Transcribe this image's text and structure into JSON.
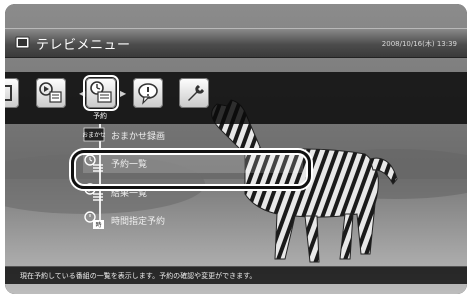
{
  "window": {
    "title": "テレビメニュー",
    "clock": "2008/10/16(木) 13:39"
  },
  "iconbar": {
    "items": [
      {
        "icon": "grid-icon"
      },
      {
        "icon": "program-guide-icon"
      },
      {
        "icon": "reservation-clock-icon",
        "label": "予約",
        "selected": true
      },
      {
        "icon": "speech-bubble-icon"
      },
      {
        "icon": "wrench-icon"
      }
    ]
  },
  "menu": {
    "items": [
      {
        "icon": "omakase-icon",
        "label": "おまかせ録画"
      },
      {
        "icon": "clock-list-icon",
        "label": "予約一覧",
        "selected": true
      },
      {
        "icon": "result-list-icon",
        "label": "結果一覧"
      },
      {
        "icon": "time-specified-icon",
        "label": "時間指定予約"
      }
    ]
  },
  "status": {
    "text": "現在予約している番組の一覧を表示します。予約の確認や変更ができます。"
  },
  "colors": {
    "highlight_ring": "#111111",
    "icon_tile": "#d9d9d9"
  }
}
